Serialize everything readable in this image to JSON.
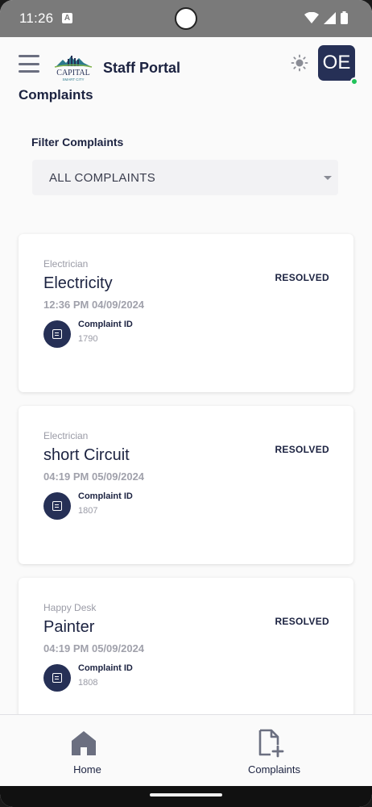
{
  "status_bar": {
    "time": "11:26",
    "notification_badge": "A"
  },
  "app_bar": {
    "title": "Staff Portal",
    "logo_text": "CAPITAL",
    "logo_subtext": "SMART CITY",
    "avatar_initials": "OE",
    "online_color": "#21c35a"
  },
  "page": {
    "title": "Complaints"
  },
  "filter": {
    "label": "Filter Complaints",
    "selected": "ALL COMPLAINTS"
  },
  "complaints": [
    {
      "category": "Electrician",
      "title": "Electricity",
      "datetime": "12:36 PM 04/09/2024",
      "status": "RESOLVED",
      "id_label": "Complaint ID",
      "id": "1790"
    },
    {
      "category": "Electrician",
      "title": "short Circuit",
      "datetime": "04:19 PM 05/09/2024",
      "status": "RESOLVED",
      "id_label": "Complaint ID",
      "id": "1807"
    },
    {
      "category": "Happy Desk",
      "title": "Painter",
      "datetime": "04:19 PM 05/09/2024",
      "status": "RESOLVED",
      "id_label": "Complaint ID",
      "id": "1808"
    }
  ],
  "bottom_nav": [
    {
      "label": "Home",
      "icon": "home-icon"
    },
    {
      "label": "Complaints",
      "icon": "file-add-icon"
    }
  ],
  "colors": {
    "primary": "#263056",
    "text": "#1b2240",
    "muted": "#9a9ba6"
  }
}
